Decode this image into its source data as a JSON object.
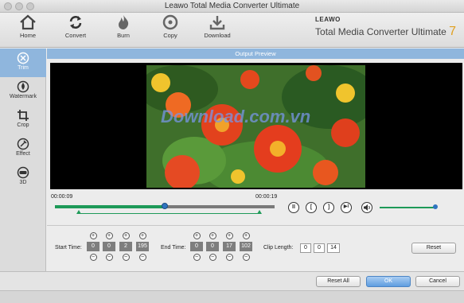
{
  "window": {
    "title": "Leawo Total Media Converter Ultimate"
  },
  "toolbar": {
    "items": [
      {
        "label": "Home",
        "icon": "home-icon"
      },
      {
        "label": "Convert",
        "icon": "convert-icon"
      },
      {
        "label": "Burn",
        "icon": "burn-icon"
      },
      {
        "label": "Copy",
        "icon": "copy-icon"
      },
      {
        "label": "Download",
        "icon": "download-icon"
      }
    ],
    "brand": {
      "company": "LEAWO",
      "product": "Total Media Converter Ultimate",
      "version": "7"
    }
  },
  "sidebar": {
    "items": [
      {
        "label": "Trim",
        "icon": "trim-icon",
        "active": true
      },
      {
        "label": "Watermark",
        "icon": "watermark-icon",
        "active": false
      },
      {
        "label": "Crop",
        "icon": "crop-icon",
        "active": false
      },
      {
        "label": "Effect",
        "icon": "effect-icon",
        "active": false
      },
      {
        "label": "3D",
        "icon": "3d-icon",
        "active": false
      }
    ]
  },
  "preview": {
    "header": "Output Preview",
    "watermark_text": "Download.com.vn"
  },
  "timeline": {
    "current_time": "00:00:09",
    "end_time": "00:00:19",
    "playhead_fraction": 0.5,
    "range_start_fraction": 0.11,
    "range_end_fraction": 0.93,
    "volume_fraction": 1.0
  },
  "controls": {
    "play_pause": "II",
    "set_start": "[",
    "set_end": "]",
    "next_frame": "▶I",
    "volume_icon": "speaker-icon"
  },
  "editor": {
    "start_label": "Start Time:",
    "start_values": [
      "0",
      "0",
      "2",
      "195"
    ],
    "end_label": "End Time:",
    "end_values": [
      "0",
      "0",
      "17",
      "102"
    ],
    "clip_label": "Clip Length:",
    "clip_values": [
      "0",
      "0",
      "14"
    ],
    "plus": "+",
    "minus": "−",
    "reset_label": "Reset"
  },
  "footer": {
    "reset_all_label": "Reset All",
    "ok_label": "OK",
    "cancel_label": "Cancel"
  },
  "colors": {
    "accent_blue": "#8fb6dd",
    "timeline_green": "#1e9a58",
    "knob_blue": "#2f74c0",
    "version_gold": "#e0a020"
  }
}
